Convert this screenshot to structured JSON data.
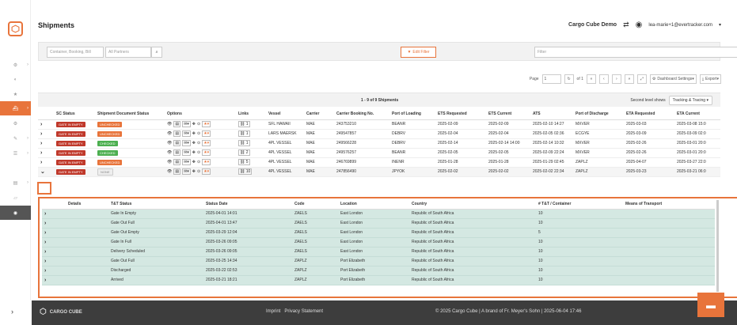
{
  "header": {
    "title": "Shipments",
    "company": "Cargo Cube Demo",
    "user_email": "lea-marie+1@evertracker.com"
  },
  "filter": {
    "search_placeholder": "Container, Booking, Bill",
    "partners_placeholder": "All Partners",
    "edit_filter_label": "Edit Filter",
    "filter_select_placeholder": "Filter"
  },
  "pager": {
    "page_label": "Page",
    "page_value": "1",
    "of_label": "of 1",
    "dashboard_settings": "Dashboard Settings",
    "export": "Export"
  },
  "list": {
    "count_text": "1 - 9 of 9 Shipments",
    "second_level_label": "Second level shows",
    "second_level_value": "Tracking & Tracing"
  },
  "columns": [
    "SC Status",
    "Shipment Document Status",
    "Options",
    "Links",
    "Vessel",
    "Carrier",
    "Carrier Booking No.",
    "Port of Loading",
    "ETS Requested",
    "ETS Current",
    "ATS",
    "Port of Discharge",
    "ETA Requested",
    "ETA Current"
  ],
  "rows": [
    {
      "sc": "GATE IN EMPTY",
      "doc": "UNCHECKED",
      "doc_color": "orange",
      "links": "1",
      "vessel": "SFL HAWAII",
      "carrier": "MAE",
      "booking": "243753210",
      "pol": "BEANR",
      "ets_req": "2025-02-09",
      "ets_cur": "2025-02-09",
      "ats": "2025-02-10 14:27",
      "pod": "MXVER",
      "eta_req": "2025-03-03",
      "eta_cur": "2025-03-08 15:0"
    },
    {
      "sc": "GATE IN EMPTY",
      "doc": "UNCHECKED",
      "doc_color": "orange",
      "links": "1",
      "vessel": "LARS MAERSK",
      "carrier": "MAE",
      "booking": "249547857",
      "pol": "DEBRV",
      "ets_req": "2025-02-04",
      "ets_cur": "2025-02-04",
      "ats": "2025-02-05 02:36",
      "pod": "ECGYE",
      "eta_req": "2025-03-09",
      "eta_cur": "2025-03-09 02:0"
    },
    {
      "sc": "GATE IN EMPTY",
      "doc": "CHECKED",
      "doc_color": "green",
      "links": "1",
      "vessel": "4PL VESSEL",
      "carrier": "MAE",
      "booking": "249566228",
      "pol": "DEBRV",
      "ets_req": "2025-02-14",
      "ets_cur": "2025-02-14 14:00",
      "ats": "2025-02-14 10:32",
      "pod": "MXVER",
      "eta_req": "2025-02-26",
      "eta_cur": "2025-03-01 20:0"
    },
    {
      "sc": "GATE IN EMPTY",
      "doc": "CHECKED",
      "doc_color": "green",
      "links": "2",
      "vessel": "4PL VESSEL",
      "carrier": "MAE",
      "booking": "249576257",
      "pol": "BEANR",
      "ets_req": "2025-02-05",
      "ets_cur": "2025-02-05",
      "ats": "2025-02-09 22:24",
      "pod": "MXVER",
      "eta_req": "2025-02-26",
      "eta_cur": "2025-03-01 20:0"
    },
    {
      "sc": "GATE IN EMPTY",
      "doc": "UNCHECKED",
      "doc_color": "orange",
      "links": "5",
      "vessel": "4PL VESSEL",
      "carrier": "MAE",
      "booking": "246769899",
      "pol": "INENR",
      "ets_req": "2025-01-28",
      "ets_cur": "2025-01-28",
      "ats": "2025-01-29 02:45",
      "pod": "ZAPLZ",
      "eta_req": "2025-04-07",
      "eta_cur": "2025-03-27 22:0"
    },
    {
      "sc": "GATE IN EMPTY",
      "doc": "NONE",
      "doc_color": "gray",
      "links": "10",
      "vessel": "4PL VESSEL",
      "carrier": "MAE",
      "booking": "247856490",
      "pol": "JPYOK",
      "ets_req": "2025-02-02",
      "ets_cur": "2025-02-02",
      "ats": "2025-02-02 22:34",
      "pod": "ZAPLZ",
      "eta_req": "2025-03-23",
      "eta_cur": "2025-03-21 06:0"
    }
  ],
  "detail_columns": [
    "Details",
    "T&T Status",
    "Status Date",
    "Code",
    "Location",
    "Country",
    "# T&T / Container",
    "Means of Transport"
  ],
  "detail_rows": [
    {
      "status": "Gate In Empty",
      "date": "2025-04-01 14:01",
      "code": "ZAELS",
      "location": "East London",
      "country": "Republic of South Africa",
      "count": "10"
    },
    {
      "status": "Gate Out Full",
      "date": "2025-04-01 13:47",
      "code": "ZAELS",
      "location": "East London",
      "country": "Republic of South Africa",
      "count": "10"
    },
    {
      "status": "Gate Out Empty",
      "date": "2025-03-29 12:04",
      "code": "ZAELS",
      "location": "East London",
      "country": "Republic of South Africa",
      "count": "5"
    },
    {
      "status": "Gate In Full",
      "date": "2025-03-26 09:05",
      "code": "ZAELS",
      "location": "East London",
      "country": "Republic of South Africa",
      "count": "10"
    },
    {
      "status": "Delivery Scheduled",
      "date": "2025-03-26 09:05",
      "code": "ZAELS",
      "location": "East London",
      "country": "Republic of South Africa",
      "count": "10"
    },
    {
      "status": "Gate Out Full",
      "date": "2025-03-25 14:34",
      "code": "ZAPLZ",
      "location": "Port Elizabeth",
      "country": "Republic of South Africa",
      "count": "10"
    },
    {
      "status": "Discharged",
      "date": "2025-03-22 02:53",
      "code": "ZAPLZ",
      "location": "Port Elizabeth",
      "country": "Republic of South Africa",
      "count": "10"
    },
    {
      "status": "Arrived",
      "date": "2025-03-21 18:21",
      "code": "ZAPLZ",
      "location": "Port Elizabeth",
      "country": "Republic of South Africa",
      "count": "10"
    }
  ],
  "footer": {
    "brand": "CARGO CUBE",
    "imprint": "Imprint",
    "privacy": "Privacy Statement",
    "copyright": "© 2025 Cargo Cube | A brand of Fr. Meyer's Sohn | 2025-06-04 17:46"
  },
  "colors": {
    "accent": "#e8743b",
    "sc_red": "#c0392b",
    "green": "#4caf50",
    "detail_bg": "#d4e8e2"
  }
}
